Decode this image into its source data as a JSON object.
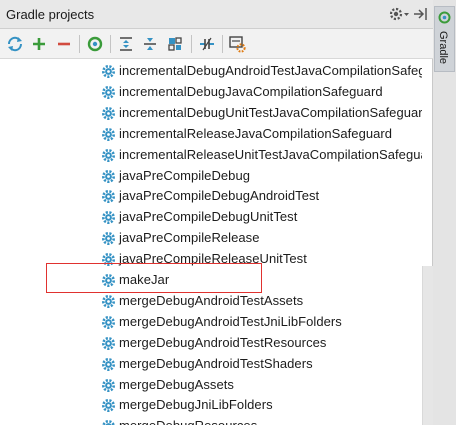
{
  "header": {
    "title": "Gradle projects"
  },
  "icons": {
    "settings": "gear-icon",
    "hide": "hide-panel-icon",
    "refresh": "refresh-icon",
    "add": "plus-icon",
    "remove": "minus-icon",
    "execute": "execute-task-icon",
    "expand_all": "expand-all-icon",
    "collapse_all": "collapse-all-icon",
    "group": "group-modules-icon",
    "offline": "offline-mode-icon",
    "project_settings": "gradle-settings-icon",
    "task": "gear-task-icon"
  },
  "tasks": [
    "incrementalDebugAndroidTestJavaCompilationSafeguard",
    "incrementalDebugJavaCompilationSafeguard",
    "incrementalDebugUnitTestJavaCompilationSafeguard",
    "incrementalReleaseJavaCompilationSafeguard",
    "incrementalReleaseUnitTestJavaCompilationSafeguard",
    "javaPreCompileDebug",
    "javaPreCompileDebugAndroidTest",
    "javaPreCompileDebugUnitTest",
    "javaPreCompileRelease",
    "javaPreCompileReleaseUnitTest",
    "makeJar",
    "mergeDebugAndroidTestAssets",
    "mergeDebugAndroidTestJniLibFolders",
    "mergeDebugAndroidTestResources",
    "mergeDebugAndroidTestShaders",
    "mergeDebugAssets",
    "mergeDebugJniLibFolders",
    "mergeDebugResources"
  ],
  "side_tab": {
    "label": "Gradle"
  },
  "colors": {
    "accent": "#3592c4",
    "highlight_border": "#e0322f",
    "add_green": "#3a9b3a",
    "remove_red": "#d24b3f"
  }
}
